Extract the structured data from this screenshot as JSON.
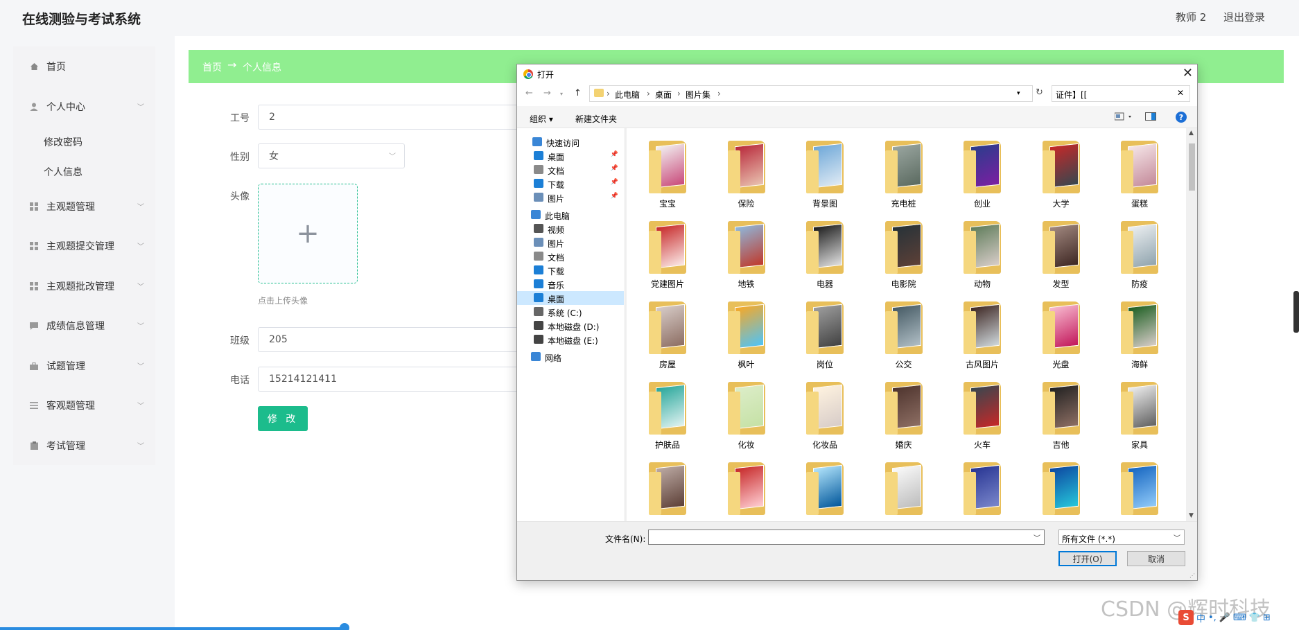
{
  "app": {
    "title": "在线测验与考试系统",
    "user": "教师 2",
    "logout": "退出登录"
  },
  "sidebar": {
    "items": [
      {
        "label": "首页",
        "icon": "home-icon"
      },
      {
        "label": "个人中心",
        "icon": "user-icon"
      },
      {
        "label": "主观题管理",
        "icon": "grid-icon"
      },
      {
        "label": "主观题提交管理",
        "icon": "grid-icon"
      },
      {
        "label": "主观题批改管理",
        "icon": "grid-icon"
      },
      {
        "label": "成绩信息管理",
        "icon": "chat-icon"
      },
      {
        "label": "试题管理",
        "icon": "briefcase-icon"
      },
      {
        "label": "客观题管理",
        "icon": "list-icon"
      },
      {
        "label": "考试管理",
        "icon": "clipboard-icon"
      }
    ],
    "sub": [
      "修改密码",
      "个人信息"
    ]
  },
  "breadcrumb": {
    "home": "首页",
    "arrow": "→",
    "current": "个人信息"
  },
  "form": {
    "id_label": "工号",
    "id_value": "2",
    "gender_label": "性别",
    "gender_value": "女",
    "avatar_label": "头像",
    "avatar_tip": "点击上传头像",
    "avatar_plus": "+",
    "class_label": "班级",
    "class_value": "205",
    "phone_label": "电话",
    "phone_value": "15214121411",
    "submit": "修 改"
  },
  "dialog": {
    "title": "打开",
    "close": "✕",
    "path": [
      "此电脑",
      "桌面",
      "图片集"
    ],
    "search_value": "证件】[[",
    "organize": "组织 ▾",
    "new_folder": "新建文件夹",
    "help": "?",
    "nav": [
      {
        "label": "快速访问",
        "icon": "star-icon",
        "color": "#3a86d6"
      },
      {
        "label": "桌面",
        "icon": "desktop-icon",
        "color": "#1c7fd6",
        "pin": true
      },
      {
        "label": "文档",
        "icon": "document-icon",
        "color": "#8a8a8a",
        "pin": true
      },
      {
        "label": "下载",
        "icon": "download-icon",
        "color": "#1c7fd6",
        "pin": true
      },
      {
        "label": "图片",
        "icon": "picture-icon",
        "color": "#6b8fb8",
        "pin": true
      },
      {
        "label": "此电脑",
        "icon": "computer-icon",
        "color": "#3a86d6"
      },
      {
        "label": "视频",
        "icon": "video-icon",
        "color": "#555555"
      },
      {
        "label": "图片",
        "icon": "picture-icon",
        "color": "#6b8fb8"
      },
      {
        "label": "文档",
        "icon": "document-icon",
        "color": "#8a8a8a"
      },
      {
        "label": "下载",
        "icon": "download-icon",
        "color": "#1c7fd6"
      },
      {
        "label": "音乐",
        "icon": "music-icon",
        "color": "#1c7fd6"
      },
      {
        "label": "桌面",
        "icon": "desktop-icon",
        "color": "#1c7fd6",
        "selected": true
      },
      {
        "label": "系统 (C:)",
        "icon": "drive-icon",
        "color": "#666666"
      },
      {
        "label": "本地磁盘 (D:)",
        "icon": "drive-icon",
        "color": "#444444"
      },
      {
        "label": "本地磁盘 (E:)",
        "icon": "drive-icon",
        "color": "#444444"
      },
      {
        "label": "网络",
        "icon": "network-icon",
        "color": "#3a86d6"
      }
    ],
    "folders": [
      {
        "name": "宝宝",
        "c1": "#f2f2f2",
        "c2": "#c94a7a"
      },
      {
        "name": "保险",
        "c1": "#b8283a",
        "c2": "#e9c2b0"
      },
      {
        "name": "背景图",
        "c1": "#6da7d8",
        "c2": "#dfeaf4"
      },
      {
        "name": "充电桩",
        "c1": "#9aa6a0",
        "c2": "#5b6a60"
      },
      {
        "name": "创业",
        "c1": "#2a3d8c",
        "c2": "#7b1fa2"
      },
      {
        "name": "大学",
        "c1": "#c62828",
        "c2": "#37474f"
      },
      {
        "name": "蛋糕",
        "c1": "#f5e6e8",
        "c2": "#c48a9a"
      },
      {
        "name": "党建图片",
        "c1": "#c62828",
        "c2": "#fbe9e7"
      },
      {
        "name": "地铁",
        "c1": "#8eb8dc",
        "c2": "#c0392b"
      },
      {
        "name": "电器",
        "c1": "#1b1b1b",
        "c2": "#e0e0e0"
      },
      {
        "name": "电影院",
        "c1": "#263238",
        "c2": "#5d4037"
      },
      {
        "name": "动物",
        "c1": "#607d5b",
        "c2": "#d7ccc8"
      },
      {
        "name": "发型",
        "c1": "#a1887f",
        "c2": "#3e2723"
      },
      {
        "name": "防疫",
        "c1": "#eceff1",
        "c2": "#90a4ae"
      },
      {
        "name": "房屋",
        "c1": "#d7ccc8",
        "c2": "#8d6e63"
      },
      {
        "name": "枫叶",
        "c1": "#f9a825",
        "c2": "#4fc3f7"
      },
      {
        "name": "岗位",
        "c1": "#9e9e9e",
        "c2": "#424242"
      },
      {
        "name": "公交",
        "c1": "#455a64",
        "c2": "#b0bec5"
      },
      {
        "name": "古风图片",
        "c1": "#3e2723",
        "c2": "#cfd8dc"
      },
      {
        "name": "光盘",
        "c1": "#f8bbd0",
        "c2": "#c2185b"
      },
      {
        "name": "海鲜",
        "c1": "#1b5e20",
        "c2": "#d7ccc8"
      },
      {
        "name": "护肤品",
        "c1": "#26a69a",
        "c2": "#e0f2f1"
      },
      {
        "name": "化妆",
        "c1": "#dcedc8",
        "c2": "#c5e1a5"
      },
      {
        "name": "化妆品",
        "c1": "#fff3e0",
        "c2": "#d7ccc8"
      },
      {
        "name": "婚庆",
        "c1": "#4e342e",
        "c2": "#8d6e63"
      },
      {
        "name": "火车",
        "c1": "#37474f",
        "c2": "#c62828"
      },
      {
        "name": "吉他",
        "c1": "#212121",
        "c2": "#8d6e63"
      },
      {
        "name": "家具",
        "c1": "#eeeeee",
        "c2": "#616161"
      },
      {
        "name": "",
        "c1": "#bcaaa4",
        "c2": "#5d4037"
      },
      {
        "name": "",
        "c1": "#c62828",
        "c2": "#ffcdd2"
      },
      {
        "name": "",
        "c1": "#b3e5fc",
        "c2": "#01579b"
      },
      {
        "name": "",
        "c1": "#fafafa",
        "c2": "#bdbdbd"
      },
      {
        "name": "",
        "c1": "#283593",
        "c2": "#7986cb"
      },
      {
        "name": "",
        "c1": "#0d47a1",
        "c2": "#26c6da"
      },
      {
        "name": "",
        "c1": "#1565c0",
        "c2": "#90caf9"
      }
    ],
    "filename_label": "文件名(N):",
    "filename_value": "",
    "filetype": "所有文件 (*.*)",
    "open": "打开(O)",
    "cancel": "取消"
  },
  "watermark": "CSDN @辉时科技",
  "ime": {
    "s": "S",
    "zh": "中",
    "punct": "•,",
    "mic": "🎤",
    "kb": "⌨",
    "shirt": "👕",
    "grid": "⊞"
  },
  "colors": {
    "accent": "#1cbc8c",
    "breadcrumb_bg": "#90ee90",
    "progress": "#2a8ce0"
  }
}
